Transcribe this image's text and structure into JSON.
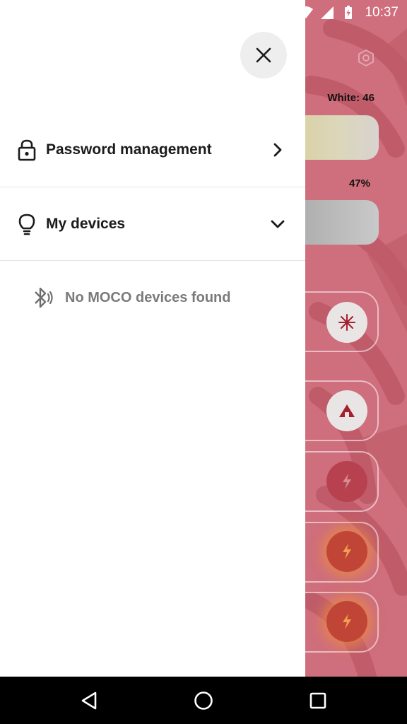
{
  "status_bar": {
    "time": "10:37",
    "icons": [
      "wifi-icon",
      "cell-signal-icon",
      "battery-charging-icon"
    ]
  },
  "background_app": {
    "white_label": "White: 46",
    "percent_label": "47%",
    "settings_icon": "hexagon-settings-icon",
    "mode_icons": [
      "snowflake-icon",
      "house-icon",
      "bolt-icon",
      "bolt-icon",
      "bolt-icon"
    ],
    "colors": {
      "background": "#cf6e7c",
      "accent_dark": "#9b2834",
      "glow": "#e88a3c"
    }
  },
  "drawer": {
    "close_icon": "close-icon",
    "items": [
      {
        "label": "Password management",
        "icon": "lock-icon",
        "trailing": "chevron-right-icon"
      },
      {
        "label": "My devices",
        "icon": "lightbulb-icon",
        "trailing": "chevron-down-icon"
      }
    ],
    "empty_state": {
      "icon": "bluetooth-searching-icon",
      "message": "No MOCO devices found"
    }
  },
  "nav_bar": {
    "buttons": [
      "back-icon",
      "home-icon",
      "recents-icon"
    ]
  }
}
